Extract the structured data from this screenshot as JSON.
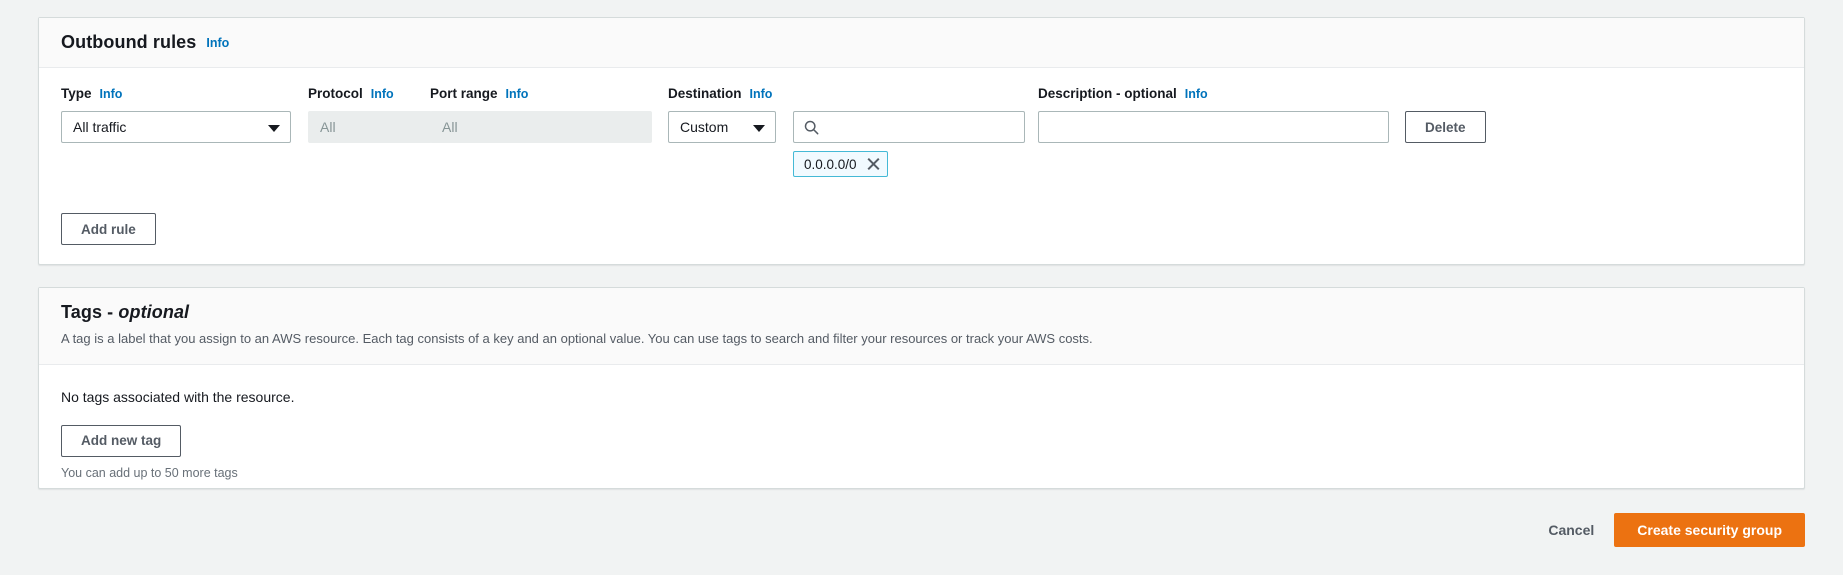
{
  "outbound": {
    "title": "Outbound rules",
    "info_label": "Info",
    "columns": [
      {
        "label": "Type",
        "info": "Info"
      },
      {
        "label": "Protocol",
        "info": "Info"
      },
      {
        "label": "Port range",
        "info": "Info"
      },
      {
        "label": "Destination",
        "info": "Info"
      },
      {
        "label": "Description - optional",
        "info": "Info"
      }
    ],
    "rule": {
      "type_value": "All traffic",
      "protocol_value": "All",
      "port_range_value": "All",
      "destination_select_value": "Custom",
      "destination_search_value": "",
      "destination_search_placeholder": "",
      "destination_token": "0.0.0.0/0",
      "description_value": "",
      "description_placeholder": "",
      "delete_label": "Delete",
      "search_icon": "search-icon",
      "remove_token_icon": "close-icon",
      "caret_icon": "chevron-down-icon"
    },
    "add_rule_label": "Add rule"
  },
  "tags": {
    "title_main": "Tags - ",
    "title_optional": "optional",
    "description": "A tag is a label that you assign to an AWS resource. Each tag consists of a key and an optional value. You can use tags to search and filter your resources or track your AWS costs.",
    "empty_text": "No tags associated with the resource.",
    "add_tag_label": "Add new tag",
    "limit_hint": "You can add up to 50 more tags"
  },
  "footer": {
    "cancel_label": "Cancel",
    "submit_label": "Create security group"
  },
  "colors": {
    "accent_orange": "#ec7211",
    "link_blue": "#0073bb",
    "token_border": "#44b9d6",
    "token_bg": "#f1faff",
    "page_bg": "#f1f3f3",
    "panel_header_bg": "#fafafa",
    "disabled_bg": "#eaeded"
  }
}
